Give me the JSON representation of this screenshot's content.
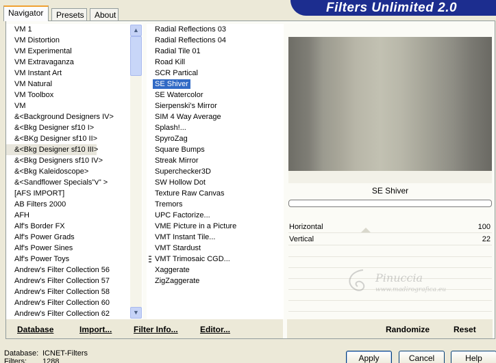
{
  "window": {
    "title": "Filters Unlimited 2.0"
  },
  "tabs": [
    {
      "label": "Navigator"
    },
    {
      "label": "Presets"
    },
    {
      "label": "About"
    }
  ],
  "categories": [
    "VM 1",
    "VM Distortion",
    "VM Experimental",
    "VM Extravaganza",
    "VM Instant Art",
    "VM Natural",
    "VM Toolbox",
    "VM",
    "&<Background Designers IV>",
    "&<Bkg Designer sf10 I>",
    "&<BKg Designer sf10 II>",
    "&<Bkg Designer sf10 III>",
    "&<Bkg Designers sf10 IV>",
    "&<Bkg Kaleidoscope>",
    "&<Sandflower Specials\"v\" >",
    "[AFS IMPORT]",
    "AB Filters 2000",
    "AFH",
    "Alf's Border FX",
    "Alf's Power Grads",
    "Alf's Power Sines",
    "Alf's Power Toys",
    "Andrew's Filter Collection 56",
    "Andrew's Filter Collection 57",
    "Andrew's Filter Collection 58",
    "Andrew's Filter Collection 60",
    "Andrew's Filter Collection 62"
  ],
  "selected_category": "&<Bkg Designer sf10 III>",
  "filters": [
    "Radial Reflections 03",
    "Radial Reflections 04",
    "Radial Tile 01",
    "Road Kill",
    "SCR  Partical",
    "SE Shiver",
    "SE Watercolor",
    "Sierpenski's Mirror",
    "SIM 4 Way Average",
    "Splash!...",
    "SpyroZag",
    "Square Bumps",
    "Streak Mirror",
    "Superchecker3D",
    "SW Hollow Dot",
    "Texture Raw Canvas",
    "Tremors",
    "UPC Factorize...",
    "VME Picture in a Picture",
    "VMT Instant Tile...",
    "VMT Stardust",
    "VMT Trimosaic CGD...",
    "Xaggerate",
    "ZigZaggerate"
  ],
  "selected_filter": "SE Shiver",
  "preview": {
    "filter_name": "SE Shiver"
  },
  "params": [
    {
      "label": "Horizontal",
      "value": "100"
    },
    {
      "label": "Vertical",
      "value": "22"
    }
  ],
  "watermark": {
    "signature": "Pinuccia",
    "url": "www.madirografica.eu"
  },
  "links": {
    "database": "Database",
    "import": "Import...",
    "filter_info": "Filter Info...",
    "editor": "Editor...",
    "randomize": "Randomize",
    "reset": "Reset"
  },
  "status": {
    "database_label": "Database:",
    "database_value": "ICNET-Filters",
    "filters_label": "Filters:",
    "filters_value": "1288"
  },
  "buttons": {
    "apply": "Apply",
    "cancel": "Cancel",
    "help": "Help"
  },
  "colors": {
    "banner": "#1c2d8f",
    "selection": "#316ac5",
    "tab_highlight": "#f0a030"
  }
}
